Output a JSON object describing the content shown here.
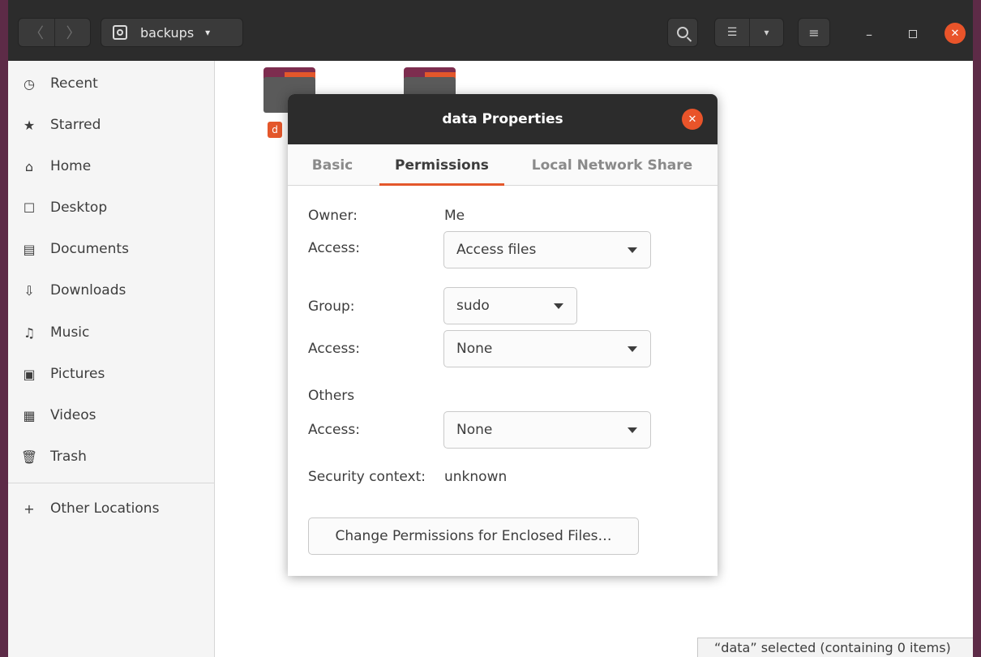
{
  "headerbar": {
    "location": "backups",
    "nav_back_glyph": "〈",
    "nav_forward_glyph": "〉",
    "caret_glyph": "▾",
    "list_view_glyph": "☰",
    "menu_glyph": "≡",
    "minimize_glyph": "–",
    "close_glyph": "✕"
  },
  "sidebar": {
    "items": [
      {
        "label": "Recent",
        "icon": "clock-icon",
        "glyph": "◷"
      },
      {
        "label": "Starred",
        "icon": "star-icon",
        "glyph": "★"
      },
      {
        "label": "Home",
        "icon": "home-icon",
        "glyph": "⌂"
      },
      {
        "label": "Desktop",
        "icon": "desktop-icon",
        "glyph": "☐"
      },
      {
        "label": "Documents",
        "icon": "documents-icon",
        "glyph": "▤"
      },
      {
        "label": "Downloads",
        "icon": "downloads-icon",
        "glyph": "⇩"
      },
      {
        "label": "Music",
        "icon": "music-icon",
        "glyph": "♫"
      },
      {
        "label": "Pictures",
        "icon": "pictures-icon",
        "glyph": "▣"
      },
      {
        "label": "Videos",
        "icon": "videos-icon",
        "glyph": "▦"
      },
      {
        "label": "Trash",
        "icon": "trash-icon",
        "glyph": "🗑"
      }
    ],
    "other_locations": {
      "label": "Other Locations",
      "icon": "plus-icon",
      "glyph": "+"
    }
  },
  "content": {
    "folder_label_initial": "d",
    "status_text": "“data” selected  (containing 0 items)"
  },
  "dialog": {
    "title": "data Properties",
    "close_glyph": "✕",
    "tabs": [
      {
        "label": "Basic",
        "active": false
      },
      {
        "label": "Permissions",
        "active": true
      },
      {
        "label": "Local Network Share",
        "active": false
      }
    ],
    "owner_label": "Owner:",
    "owner_value": "Me",
    "owner_access_label": "Access:",
    "owner_access_value": "Access files",
    "group_label": "Group:",
    "group_value": "sudo",
    "group_access_label": "Access:",
    "group_access_value": "None",
    "others_label": "Others",
    "others_access_label": "Access:",
    "others_access_value": "None",
    "security_label": "Security context:",
    "security_value": "unknown",
    "enclosed_button": "Change Permissions for Enclosed Files…"
  },
  "colors": {
    "accent": "#e9542a",
    "headerbar": "#2c2c2c",
    "frame": "#5d2b47"
  }
}
